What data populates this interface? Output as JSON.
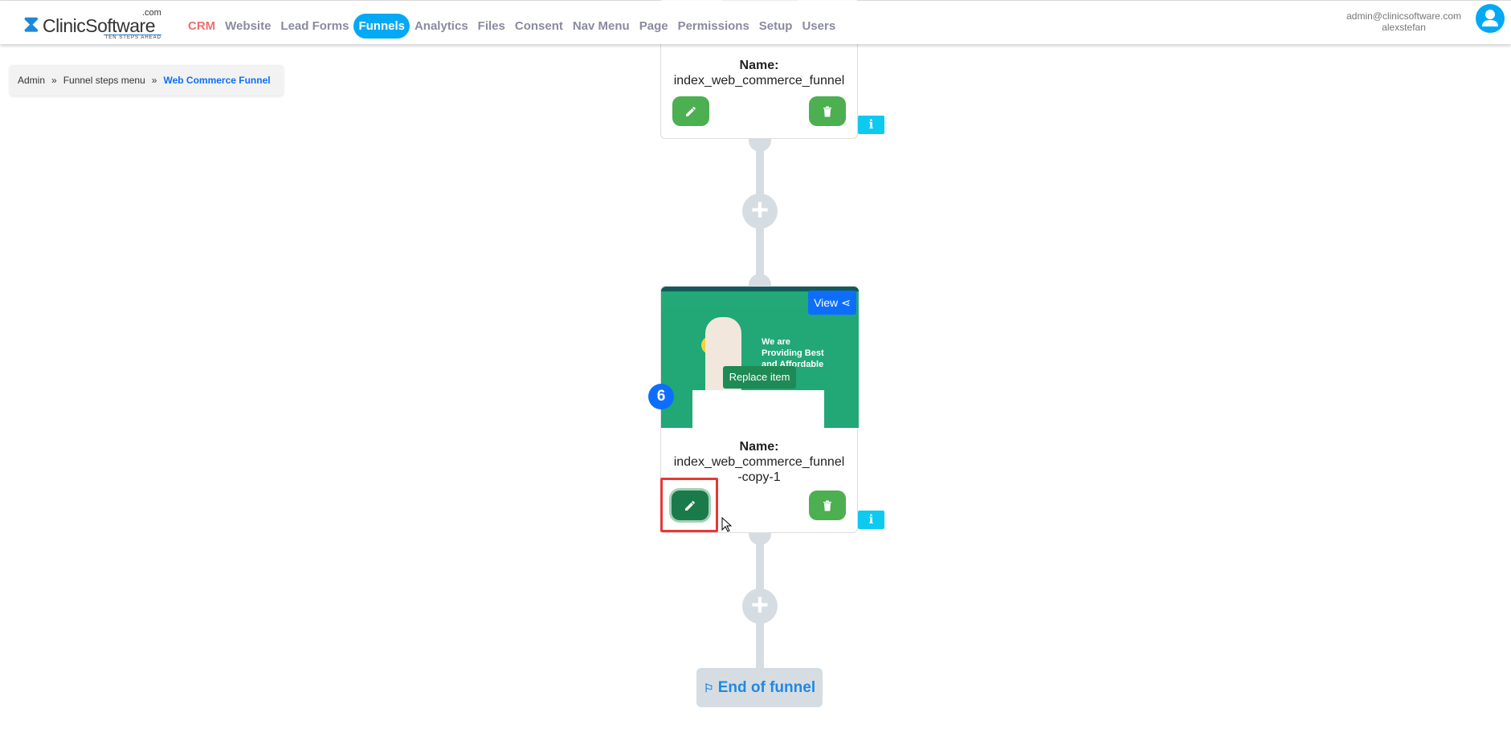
{
  "header": {
    "logo": {
      "name": "ClinicSoftware",
      "suffix": ".com",
      "tagline": "TEN STEPS AHEAD"
    },
    "nav": [
      {
        "label": "CRM"
      },
      {
        "label": "Website"
      },
      {
        "label": "Lead Forms"
      },
      {
        "label": "Funnels",
        "active": true
      },
      {
        "label": "Analytics"
      },
      {
        "label": "Files"
      },
      {
        "label": "Consent"
      },
      {
        "label": "Nav Menu"
      },
      {
        "label": "Page"
      },
      {
        "label": "Permissions"
      },
      {
        "label": "Setup"
      },
      {
        "label": "Users"
      }
    ],
    "user": {
      "email": "admin@clinicsoftware.com",
      "username": "alexstefan",
      "icon": "user-icon"
    }
  },
  "breadcrumb": {
    "items": [
      "Admin",
      "Funnel steps menu"
    ],
    "separator": "»",
    "current": "Web Commerce Funnel"
  },
  "steps": [
    {
      "name_label": "Name:",
      "name": "index_web_commerce_funnel",
      "info": "i"
    },
    {
      "number": "6",
      "name_label": "Name:",
      "name": "index_web_commerce_funnel-copy-1",
      "view_label": "View",
      "replace_label": "Replace item",
      "info": "i",
      "preview": {
        "headline": "We are Providing Best and Affordable"
      }
    }
  ],
  "add_icon": "+",
  "end": {
    "icon": "flag-icon",
    "label": "End of funnel"
  },
  "colors": {
    "accent": "#03a9f4",
    "green": "#4caf50",
    "edit_active": "#1b7a4a",
    "primary": "#0d6efd",
    "info": "#0dcaf0",
    "highlight": "#e53935"
  }
}
